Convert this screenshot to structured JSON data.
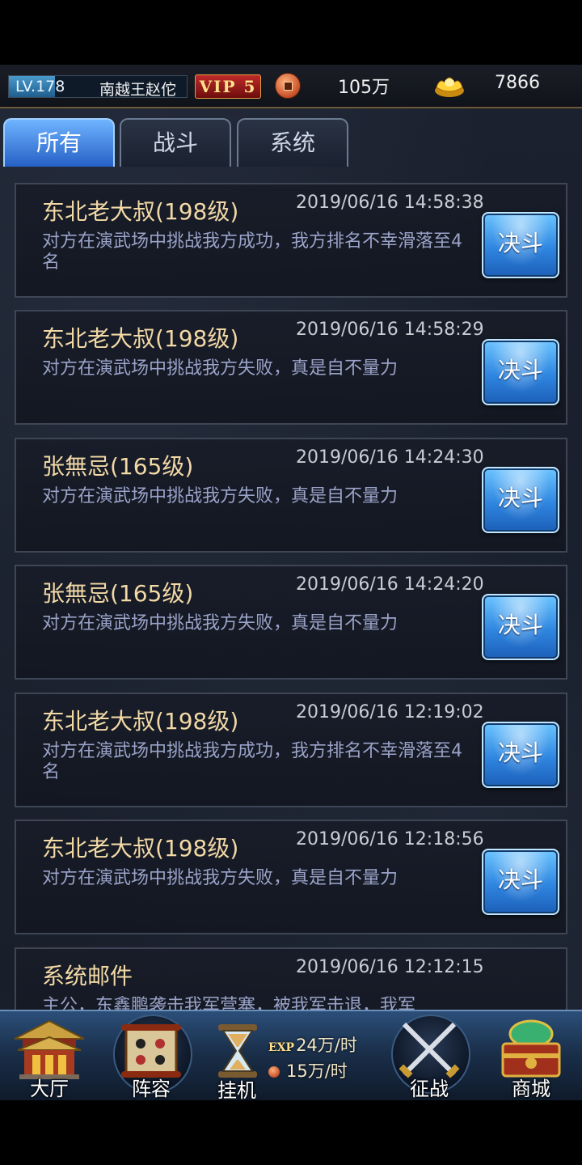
{
  "status_bar": {
    "level_label": "LV.178",
    "level_progress": 0.26,
    "player_name": "南越王赵佗",
    "vip_label": "VIP 5",
    "coin_icon": "copper-coin-icon",
    "coins": "105万",
    "ingot_icon": "gold-ingot-icon",
    "gold": "7866"
  },
  "tabs": [
    {
      "label": "所有",
      "active": true
    },
    {
      "label": "战斗",
      "active": false
    },
    {
      "label": "系统",
      "active": false
    }
  ],
  "messages": [
    {
      "sender": "东北老大叔(198级)",
      "time": "2019/06/16 14:58:38",
      "body": "对方在演武场中挑战我方成功，我方排名不幸滑落至4名",
      "action": "决斗"
    },
    {
      "sender": "东北老大叔(198级)",
      "time": "2019/06/16 14:58:29",
      "body": "对方在演武场中挑战我方失败，真是自不量力",
      "action": "决斗"
    },
    {
      "sender": "张無忌(165级)",
      "time": "2019/06/16 14:24:30",
      "body": "对方在演武场中挑战我方失败，真是自不量力",
      "action": "决斗"
    },
    {
      "sender": "张無忌(165级)",
      "time": "2019/06/16 14:24:20",
      "body": "对方在演武场中挑战我方失败，真是自不量力",
      "action": "决斗"
    },
    {
      "sender": "东北老大叔(198级)",
      "time": "2019/06/16 12:19:02",
      "body": "对方在演武场中挑战我方成功，我方排名不幸滑落至4名",
      "action": "决斗"
    },
    {
      "sender": "东北老大叔(198级)",
      "time": "2019/06/16 12:18:56",
      "body": "对方在演武场中挑战我方失败，真是自不量力",
      "action": "决斗"
    },
    {
      "sender": "系统邮件",
      "time": "2019/06/16 12:12:15",
      "body": "主公，东鑫鹏袭击我军营寨，被我军击退，我军",
      "action": ""
    }
  ],
  "bottom_nav": {
    "hall": {
      "label": "大厅",
      "icon": "palace-icon"
    },
    "lineup": {
      "label": "阵容",
      "icon": "formation-scroll-icon"
    },
    "idle": {
      "label": "挂机",
      "icon": "hourglass-icon",
      "exp_tag": "EXP",
      "exp_rate": "24万/时",
      "coin_rate": "15万/时"
    },
    "campaign": {
      "label": "征战",
      "icon": "crossed-swords-icon"
    },
    "shop": {
      "label": "商城",
      "icon": "treasure-chest-icon"
    }
  }
}
